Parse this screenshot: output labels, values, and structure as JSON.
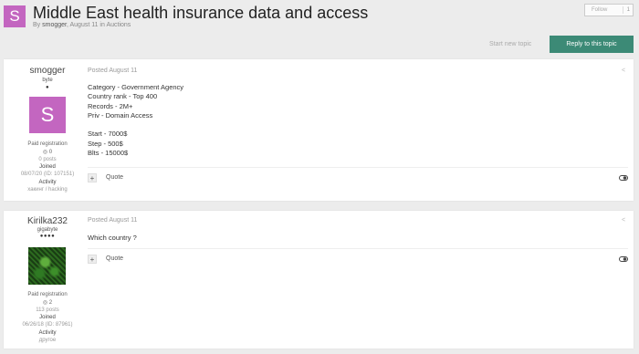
{
  "header": {
    "avatar_letter": "S",
    "title": "Middle East health insurance data and access",
    "meta_prefix": "By ",
    "author": "smogger",
    "meta_rest": ", August 11 in Auctions",
    "follow_label": "Follow",
    "follow_count": "1"
  },
  "actions": {
    "start_new_topic": "Start new topic",
    "reply": "Reply to this topic"
  },
  "posts": [
    {
      "username": "smogger",
      "rank": "byte",
      "rank_pips": "●",
      "avatar_letter": "S",
      "group": "Paid registration",
      "reputation": "0",
      "posts": "0 posts",
      "joined_label": "Joined",
      "joined": "08/07/20 (ID: 107151)",
      "activity_label": "Activity",
      "activity": "хакинг / hacking",
      "posted": "Posted August 11",
      "lines": [
        "Category - Government Agency",
        "Country rank - Top 400",
        "Records - 2M+",
        "Priv - Domain Access",
        "",
        "Start - 7000$",
        "Step - 500$",
        "Blts - 15000$"
      ],
      "quote": "Quote"
    },
    {
      "username": "Kirilka232",
      "rank": "gigabyte",
      "rank_pips": "●●●●",
      "group": "Paid registration",
      "reputation": "2",
      "posts": "113 posts",
      "joined_label": "Joined",
      "joined": "06/26/18 (ID: 87961)",
      "activity_label": "Activity",
      "activity": "другое",
      "posted": "Posted August 11",
      "lines": [
        "Which country ?"
      ],
      "quote": "Quote"
    }
  ],
  "icons": {
    "multiquote": "+",
    "share": "<",
    "reputation_badge": "◎"
  }
}
